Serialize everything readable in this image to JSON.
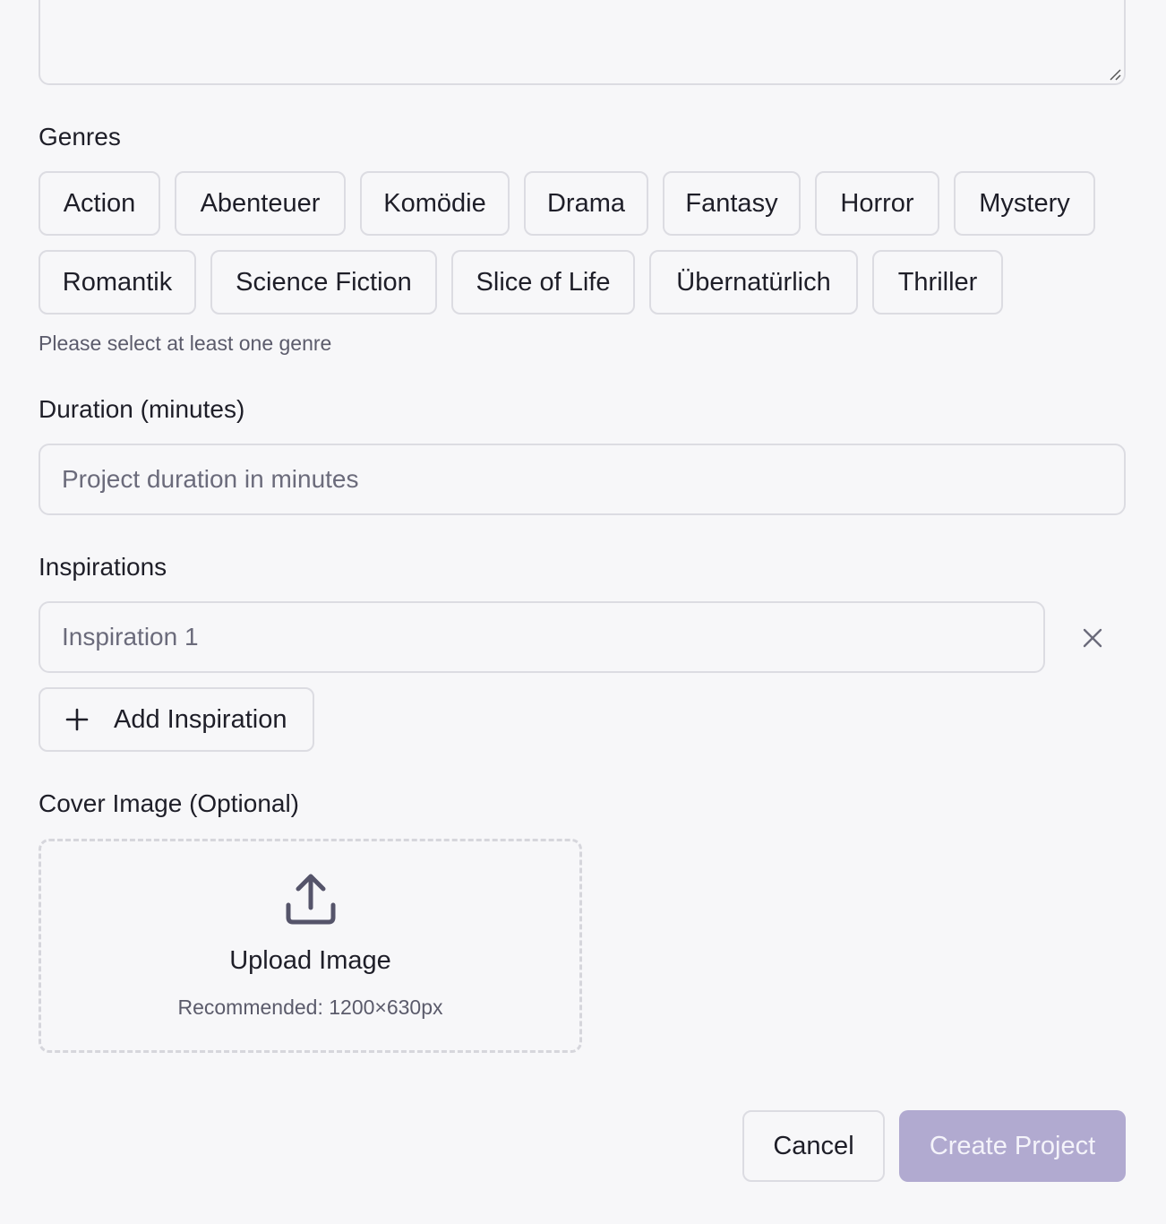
{
  "genres": {
    "label": "Genres",
    "items": [
      "Action",
      "Abenteuer",
      "Komödie",
      "Drama",
      "Fantasy",
      "Horror",
      "Mystery",
      "Romantik",
      "Science Fiction",
      "Slice of Life",
      "Übernatürlich",
      "Thriller"
    ],
    "hint": "Please select at least one genre"
  },
  "duration": {
    "label": "Duration (minutes)",
    "placeholder": "Project duration in minutes",
    "value": ""
  },
  "inspirations": {
    "label": "Inspirations",
    "items": [
      {
        "placeholder": "Inspiration 1",
        "value": ""
      }
    ],
    "add_label": "Add Inspiration",
    "remove_icon": "close-icon",
    "add_icon": "plus-icon"
  },
  "cover": {
    "label": "Cover Image (Optional)",
    "upload_title": "Upload Image",
    "upload_hint": "Recommended: 1200×630px",
    "icon": "upload-icon"
  },
  "actions": {
    "cancel_label": "Cancel",
    "create_label": "Create Project",
    "create_color": "#b1aad0"
  }
}
